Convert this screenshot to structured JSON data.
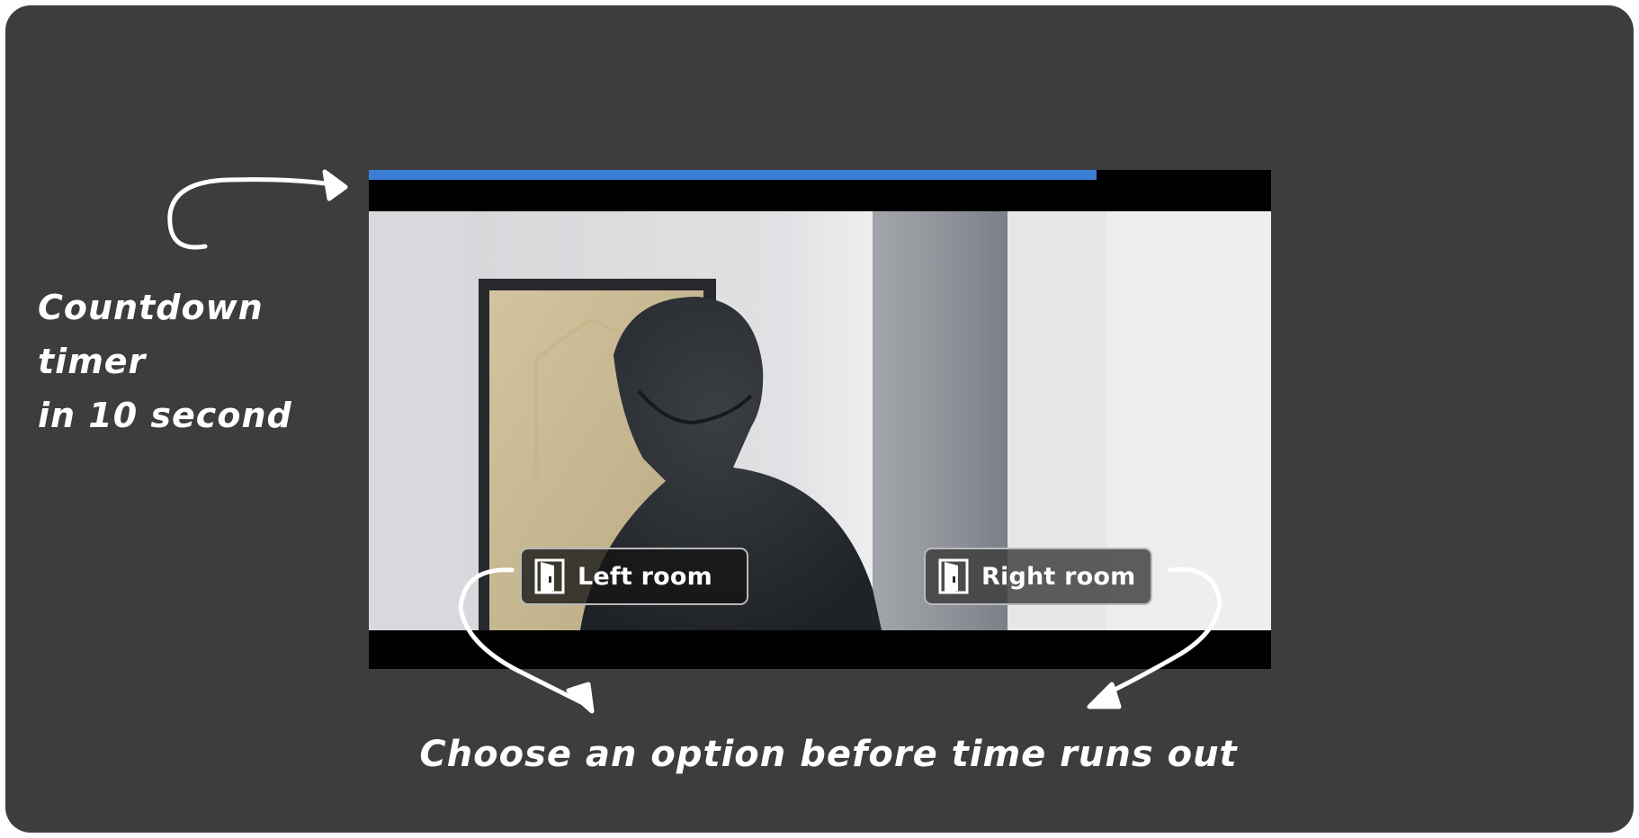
{
  "annotations": {
    "timer_note": "Countdown timer\n in 10 second",
    "choose_note": "Choose an option before time runs out"
  },
  "player": {
    "timer_progress": 0.807,
    "timer_color": "#3a7fd5",
    "choices": [
      {
        "label": "Left room",
        "icon": "door-icon"
      },
      {
        "label": "Right room",
        "icon": "door-icon"
      }
    ]
  },
  "colors": {
    "background": "#3d3d3d",
    "annotation": "#ffffff"
  }
}
